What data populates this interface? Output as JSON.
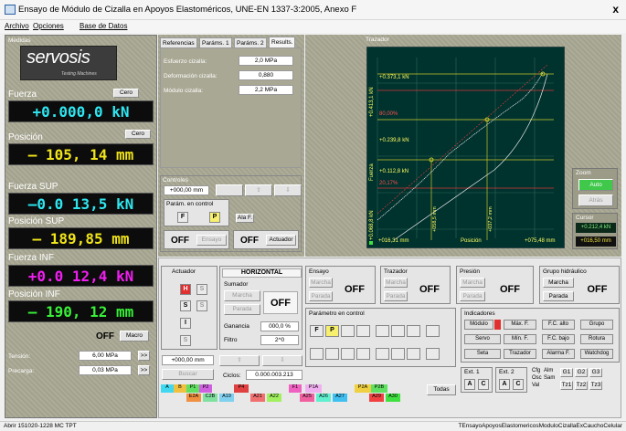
{
  "window": {
    "title": "Ensayo de Módulo de Cizalla en Apoyos Elastoméricos, UNE-EN 1337-3:2005, Anexo F",
    "close": "x"
  },
  "menu": [
    "Archivo",
    "Opciones",
    "Base de Datos"
  ],
  "medidas": {
    "title": "Medidas",
    "logo": "servosis",
    "logo_sub": "Testing Machines",
    "fuerza_label": "Fuerza",
    "fuerza_value": "+0.000,0 kN",
    "cero": "Cero",
    "posicion_label": "Posición",
    "posicion_value": "– 105, 14 mm",
    "fsup_label": "Fuerza SUP",
    "fsup_value": "–0.0 13,5 kN",
    "psup_label": "Posición SUP",
    "psup_value": "– 189,85 mm",
    "finf_label": "Fuerza INF",
    "finf_value": "+0.0 12,4 kN",
    "pinf_label": "Posición INF",
    "pinf_value": "– 190, 12 mm",
    "off": "OFF",
    "macro": "Macro",
    "tension_label": "Tensión:",
    "tension_value": "6,00 MPa",
    "precarga_label": "Precarga:",
    "precarga_value": "0,03 MPa",
    "arrow": ">>"
  },
  "tabs": [
    "Referencias",
    "Paráms. 1",
    "Paráms. 2",
    "Results."
  ],
  "results": [
    {
      "label": "Esfuerzo cizalla:",
      "value": "2,0 MPa"
    },
    {
      "label": "Deformación cizalla:",
      "value": "0,880"
    },
    {
      "label": "Módulo cizalla:",
      "value": "2,2 MPa"
    }
  ],
  "controles": {
    "title": "Controles",
    "value": "+000,00 mm",
    "param_title": "Parám. en control",
    "f": "F",
    "p": "P",
    "alaf": "Ala F.",
    "off1": "OFF",
    "ensayo": "Ensayo",
    "off2": "OFF",
    "actuador": "Actuador"
  },
  "trazador": {
    "title": "Trazador",
    "ylabel": "Fuerza",
    "xlabel": "Posición",
    "xmin": "+016,31 mm",
    "xmax": "+075,48 mm",
    "ymin": "+0.068,8 kN",
    "ytop": "+0.413,1 kN",
    "labels": [
      "+0.373,1 kN",
      "+0.239,8 kN",
      "+0.112,8 kN"
    ],
    "pct": [
      "80,00%",
      "20,17%"
    ],
    "vmarks": [
      "+058,5 mm",
      "+037,2 mm"
    ]
  },
  "zoom": {
    "title": "Zoom",
    "auto": "Auto",
    "atras": "Atrás"
  },
  "cursor": {
    "title": "Cursor",
    "v1": "+0.212,4 kN",
    "v2": "+016,50 mm"
  },
  "actuador": {
    "title": "Actuador",
    "mode": "HORIZONTAL",
    "h": "H",
    "s": "S",
    "i": "I",
    "sumador": "Sumador",
    "marcha": "Marcha",
    "parada": "Parada",
    "off": "OFF",
    "ganancia_label": "Ganancia",
    "ganancia": "000,0 %",
    "filtro_label": "Filtro",
    "filtro": "2^0",
    "pos": "+000,00 mm",
    "buscar": "Buscar",
    "ciclos_label": "Ciclos:",
    "ciclos": "0.000.003.213"
  },
  "ensayo": {
    "title": "Ensayo",
    "marcha": "Marcha",
    "parada": "Parada",
    "off": "OFF"
  },
  "trazador2": {
    "title": "Trazador",
    "marcha": "Marcha",
    "parada": "Parada",
    "off": "OFF"
  },
  "presion": {
    "title": "Presión",
    "marcha": "Marcha",
    "parada": "Parada",
    "off": "OFF"
  },
  "grupo": {
    "title": "Grupo hidráulico",
    "marcha": "Marcha",
    "parada": "Parada",
    "off": "OFF"
  },
  "parametro": {
    "title": "Parámetro en control",
    "f": "F",
    "p": "P"
  },
  "indicadores": {
    "title": "Indicadores",
    "items": [
      "Módulo",
      "Máx. F.",
      "F.C. alto",
      "Grupo",
      "Servo",
      "Mín. F.",
      "F.C. bajo",
      "Rotura",
      "Seta",
      "Trazador",
      "Alarma F.",
      "Watchdog"
    ]
  },
  "ext": {
    "e1": "Ext. 1",
    "e2": "Ext. 2",
    "a": "A",
    "c": "C",
    "cfg": "Cfg",
    "alm": "Alm",
    "osc": "Osc",
    "sam": "Sam",
    "val": "Val",
    "g1": "G1",
    "g2": "G2",
    "g3": "G3",
    "tz1": "Tz1",
    "tz2": "Tz2",
    "tz3": "Tz3"
  },
  "todas": "Todas",
  "channels": [
    "A",
    "B",
    "P1",
    "P2",
    "P4",
    "F1",
    "P1A",
    "P2A",
    "P2B",
    "E2A",
    "C2B",
    "A19",
    "A21",
    "A22",
    "A25",
    "A26",
    "A27",
    "A29",
    "A30"
  ],
  "status": {
    "left": "Abrir 151020-1228 MC TPT",
    "right": "TEnsayoApoyosElastomericosModuloCizallaExCauchoCelular"
  }
}
